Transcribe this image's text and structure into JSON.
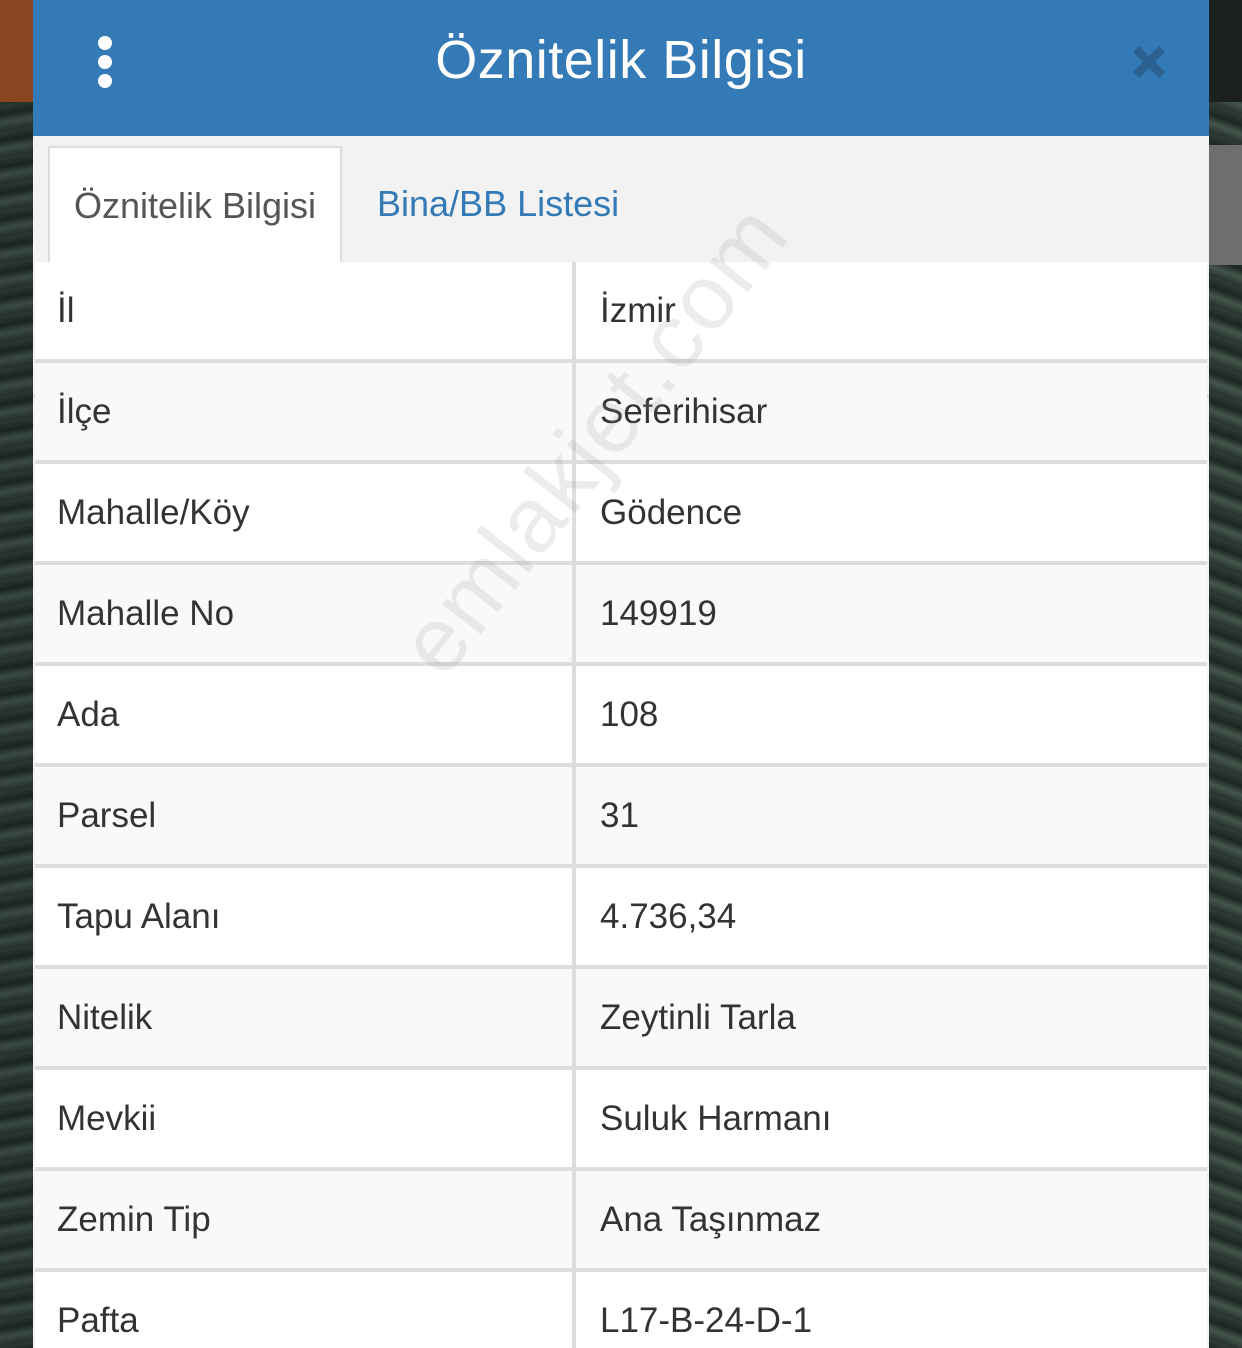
{
  "header": {
    "title": "Öznitelik Bilgisi"
  },
  "tabs": [
    {
      "label": "Öznitelik Bilgisi",
      "active": true
    },
    {
      "label": "Bina/BB Listesi",
      "active": false
    }
  ],
  "rows": [
    {
      "label": "İl",
      "value": "İzmir"
    },
    {
      "label": "İlçe",
      "value": "Seferihisar"
    },
    {
      "label": "Mahalle/Köy",
      "value": "Gödence"
    },
    {
      "label": "Mahalle No",
      "value": "149919"
    },
    {
      "label": "Ada",
      "value": "108"
    },
    {
      "label": "Parsel",
      "value": "31"
    },
    {
      "label": "Tapu Alanı",
      "value": "4.736,34"
    },
    {
      "label": "Nitelik",
      "value": "Zeytinli Tarla"
    },
    {
      "label": "Mevkii",
      "value": "Suluk Harmanı"
    },
    {
      "label": "Zemin Tip",
      "value": "Ana Taşınmaz"
    },
    {
      "label": "Pafta",
      "value": "L17-B-24-D-1"
    }
  ],
  "watermark": "emlakjet.com",
  "colors": {
    "header_bg": "#337ab7",
    "link": "#337ab7",
    "border": "#dddddd"
  },
  "icons": {
    "menu": "more-vertical-icon",
    "close": "close-icon"
  }
}
